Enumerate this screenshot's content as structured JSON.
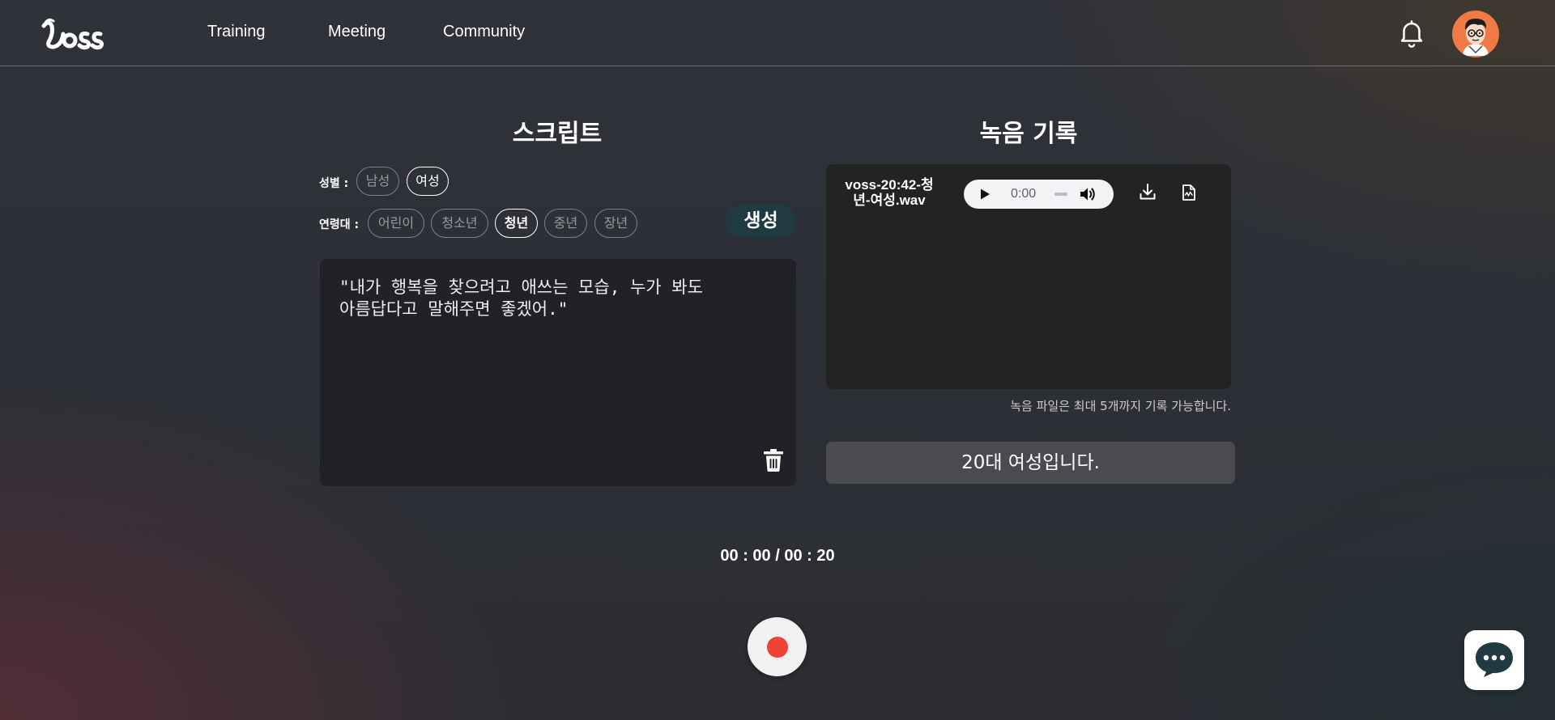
{
  "nav": {
    "logo_alt": "voss",
    "links": [
      "Training",
      "Meeting",
      "Community"
    ]
  },
  "script_section": {
    "title": "스크립트",
    "gender_label": "성별 :",
    "gender_options": [
      "남성",
      "여성"
    ],
    "gender_selected": "여성",
    "age_label": "연령대 :",
    "age_options": [
      "어린이",
      "청소년",
      "청년",
      "중년",
      "장년"
    ],
    "age_selected": "청년",
    "generate_label": "생성",
    "script_text": "\"내가 행복을 찾으려고 애쓰는 모습, 누가 봐도\n아름답다고 말해주면 좋겠어.\""
  },
  "record_section": {
    "title": "녹음 기록",
    "recording": {
      "filename": "voss-20:42-청년-여성.wav",
      "audio_time": "0:00"
    },
    "note": "녹음 파일은 최대 5개까지 기록 가능합니다.",
    "result": "20대 여성입니다."
  },
  "timer": "00 : 00 / 00 : 20",
  "colors": {
    "generate_bg": "#1f3a40",
    "record_dot": "#ef4234",
    "avatar_bg": "#f07a45",
    "chat_icon": "#1f3a40"
  },
  "icons": [
    "bell-icon",
    "avatar",
    "play-icon",
    "volume-icon",
    "download-icon",
    "transcript-icon",
    "trash-icon",
    "record-icon",
    "chat-icon"
  ]
}
